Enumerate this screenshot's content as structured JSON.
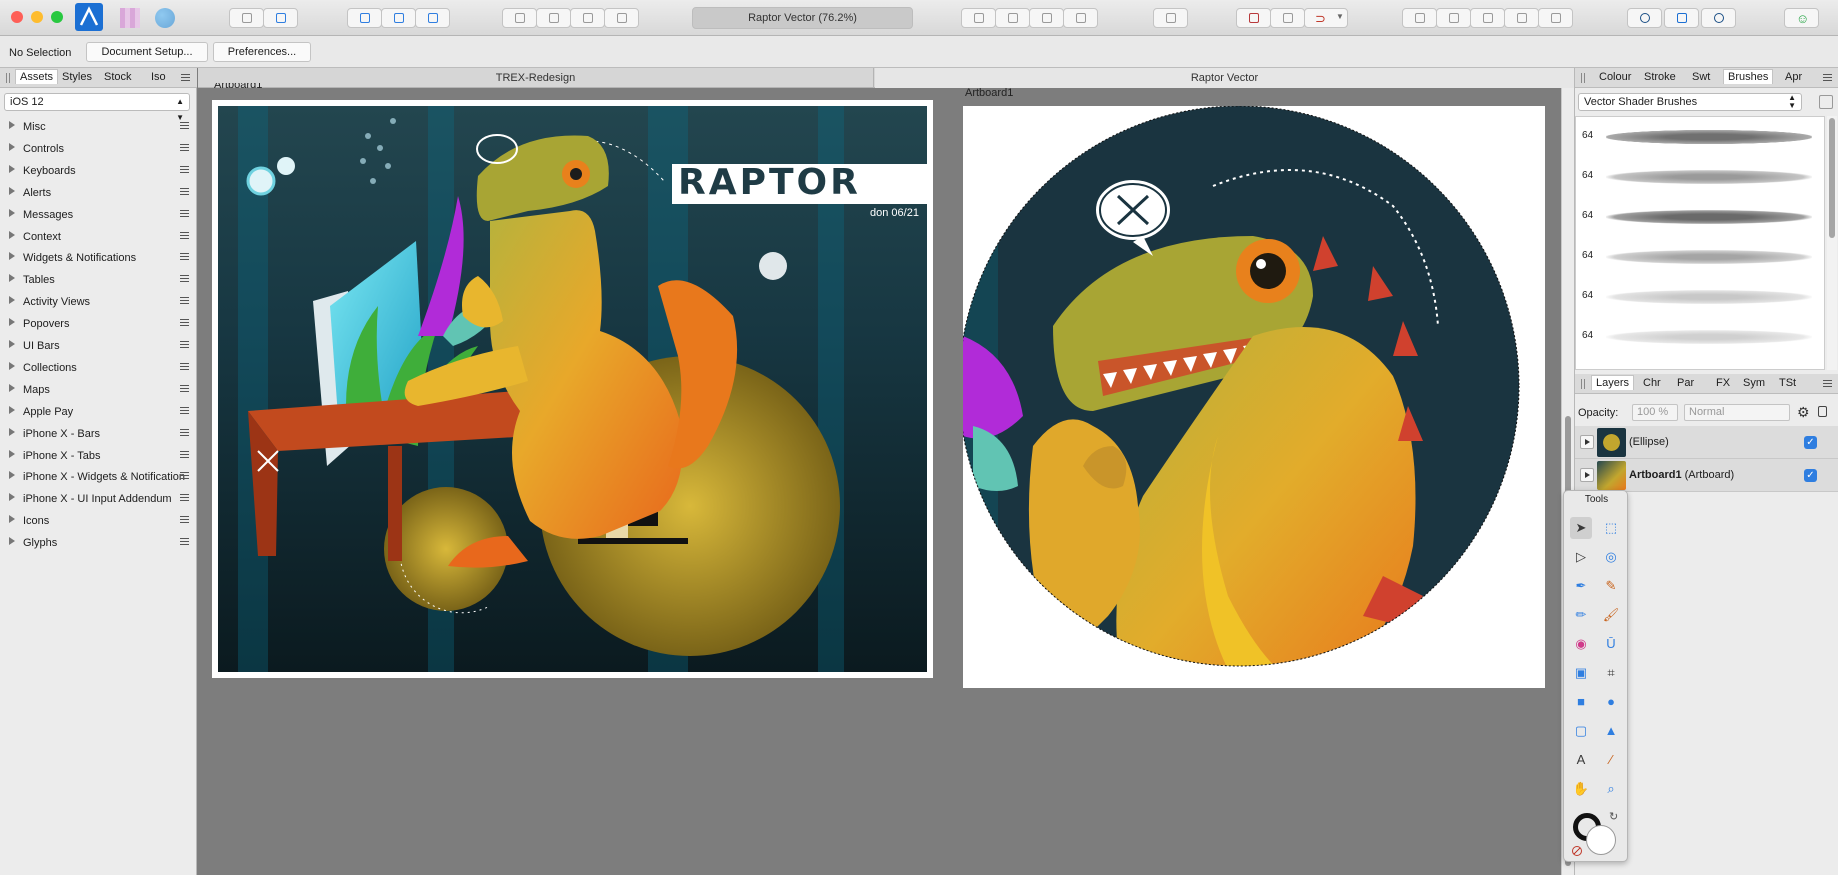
{
  "window": {
    "title": "Raptor Vector (76.2%)"
  },
  "context_bar": {
    "selection_label": "No Selection",
    "document_setup_label": "Document Setup...",
    "preferences_label": "Preferences..."
  },
  "left_panel": {
    "tabs": [
      "Assets",
      "Styles",
      "Stock",
      "Iso"
    ],
    "active_tab": "Assets",
    "dropdown_value": "iOS 12",
    "categories": [
      "Misc",
      "Controls",
      "Keyboards",
      "Alerts",
      "Messages",
      "Context",
      "Widgets & Notifications",
      "Tables",
      "Activity Views",
      "Popovers",
      "UI Bars",
      "Collections",
      "Maps",
      "Apple Pay",
      "iPhone X - Bars",
      "iPhone X - Tabs",
      "iPhone X - Widgets & Notifications",
      "iPhone X - UI Input Addendum",
      "Icons",
      "Glyphs"
    ]
  },
  "document_tabs": [
    "TREX-Redesign",
    "Raptor Vector"
  ],
  "canvas": {
    "artboard1_label": "Artboard1",
    "artboard2_label": "Artboard1",
    "poster_title": "RAPTOR",
    "poster_subtitle": "don 06/21"
  },
  "right_panel": {
    "top_tabs": [
      "Colour",
      "Stroke",
      "Swt",
      "Brushes",
      "Apr"
    ],
    "active_top_tab": "Brushes",
    "brush_category": "Vector Shader Brushes",
    "brush_sizes": [
      "64",
      "64",
      "64",
      "64",
      "64",
      "64"
    ],
    "bottom_tabs": [
      "Layers",
      "Chr",
      "Par",
      "FX",
      "Sym",
      "TSt"
    ],
    "active_bottom_tab": "Layers",
    "opacity_label": "Opacity:",
    "opacity_value": "100 %",
    "blend_mode": "Normal",
    "layers": [
      {
        "name": "(Ellipse)",
        "bold": "",
        "visible": true
      },
      {
        "name": " (Artboard)",
        "bold": "Artboard1",
        "visible": true
      }
    ]
  },
  "tools_panel": {
    "title": "Tools",
    "tools": [
      "move-tool",
      "artboard-tool",
      "node-tool",
      "corner-tool",
      "pen-tool",
      "vector-brush-tool",
      "pencil-tool",
      "paint-brush-tool",
      "fill-tool",
      "transparency-tool",
      "place-image-tool",
      "crop-tool",
      "rectangle-tool",
      "ellipse-tool",
      "rounded-rectangle-tool",
      "triangle-tool",
      "text-tool",
      "color-picker-tool",
      "hand-tool",
      "zoom-tool"
    ]
  },
  "colors": {
    "accent": "#2f7ee0",
    "poster_yellow": "#c9b02a",
    "dino_green": "#a8a534",
    "dino_orange": "#e8811c"
  }
}
